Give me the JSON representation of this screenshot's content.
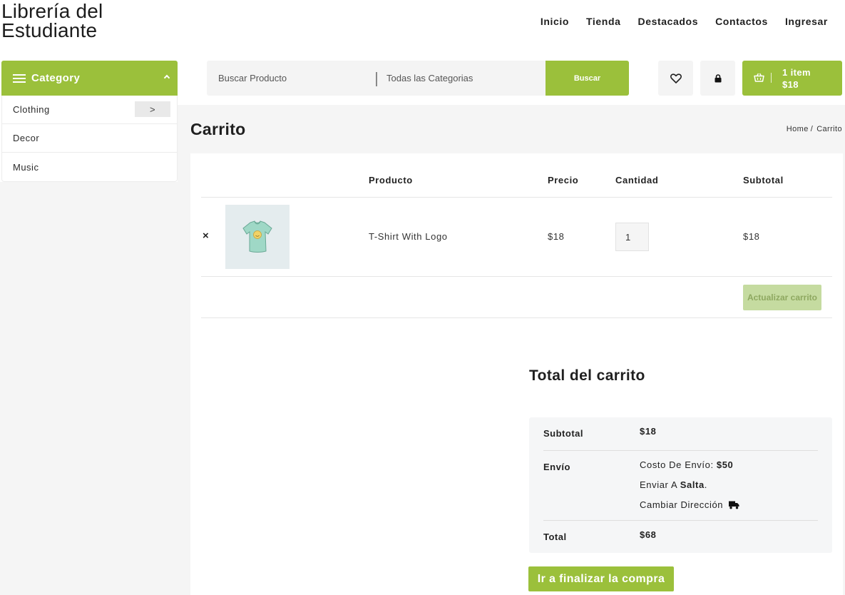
{
  "site": {
    "title_line1": "Librería del",
    "title_line2": "Estudiante"
  },
  "nav": [
    "Inicio",
    "Tienda",
    "Destacados",
    "Contactos",
    "Ingresar"
  ],
  "category": {
    "header": "Category",
    "items": [
      {
        "label": "Clothing",
        "arrow": ">"
      },
      {
        "label": "Decor"
      },
      {
        "label": "Music"
      }
    ]
  },
  "search": {
    "placeholder": "Buscar Producto",
    "category": "Todas las Categorias",
    "button": "Buscar"
  },
  "header_icons": {
    "wishlist": "heart-icon",
    "account": "lock-icon",
    "cart": "basket-icon"
  },
  "cart_button": {
    "count": "1 item",
    "amount": "$18"
  },
  "page": {
    "title": "Carrito",
    "breadcrumb_home": "Home",
    "breadcrumb_sep": "/",
    "breadcrumb_current": "Carrito"
  },
  "table": {
    "headers": {
      "product": "Producto",
      "price": "Precio",
      "quantity": "Cantidad",
      "subtotal": "Subtotal"
    },
    "rows": [
      {
        "remove": "×",
        "product": "T-Shirt With Logo",
        "price": "$18",
        "quantity": "1",
        "subtotal": "$18"
      }
    ],
    "update_button": "Actualizar carrito"
  },
  "totals": {
    "title": "Total del carrito",
    "subtotal_label": "Subtotal",
    "subtotal_value": "$18",
    "shipping_label": "Envío",
    "shipping_cost_prefix": "Costo De Envío:",
    "shipping_cost": "$50",
    "ship_to_prefix": "Enviar A",
    "ship_to_place": "Salta",
    "ship_to_suffix": ".",
    "change_address": "Cambiar Dirección",
    "total_label": "Total",
    "total_value": "$68"
  },
  "checkout_button": "Ir a finalizar la compra",
  "colors": {
    "accent": "#9bc03b",
    "accent_light": "#c5dba0",
    "bg_grey": "#f5f5f5"
  }
}
